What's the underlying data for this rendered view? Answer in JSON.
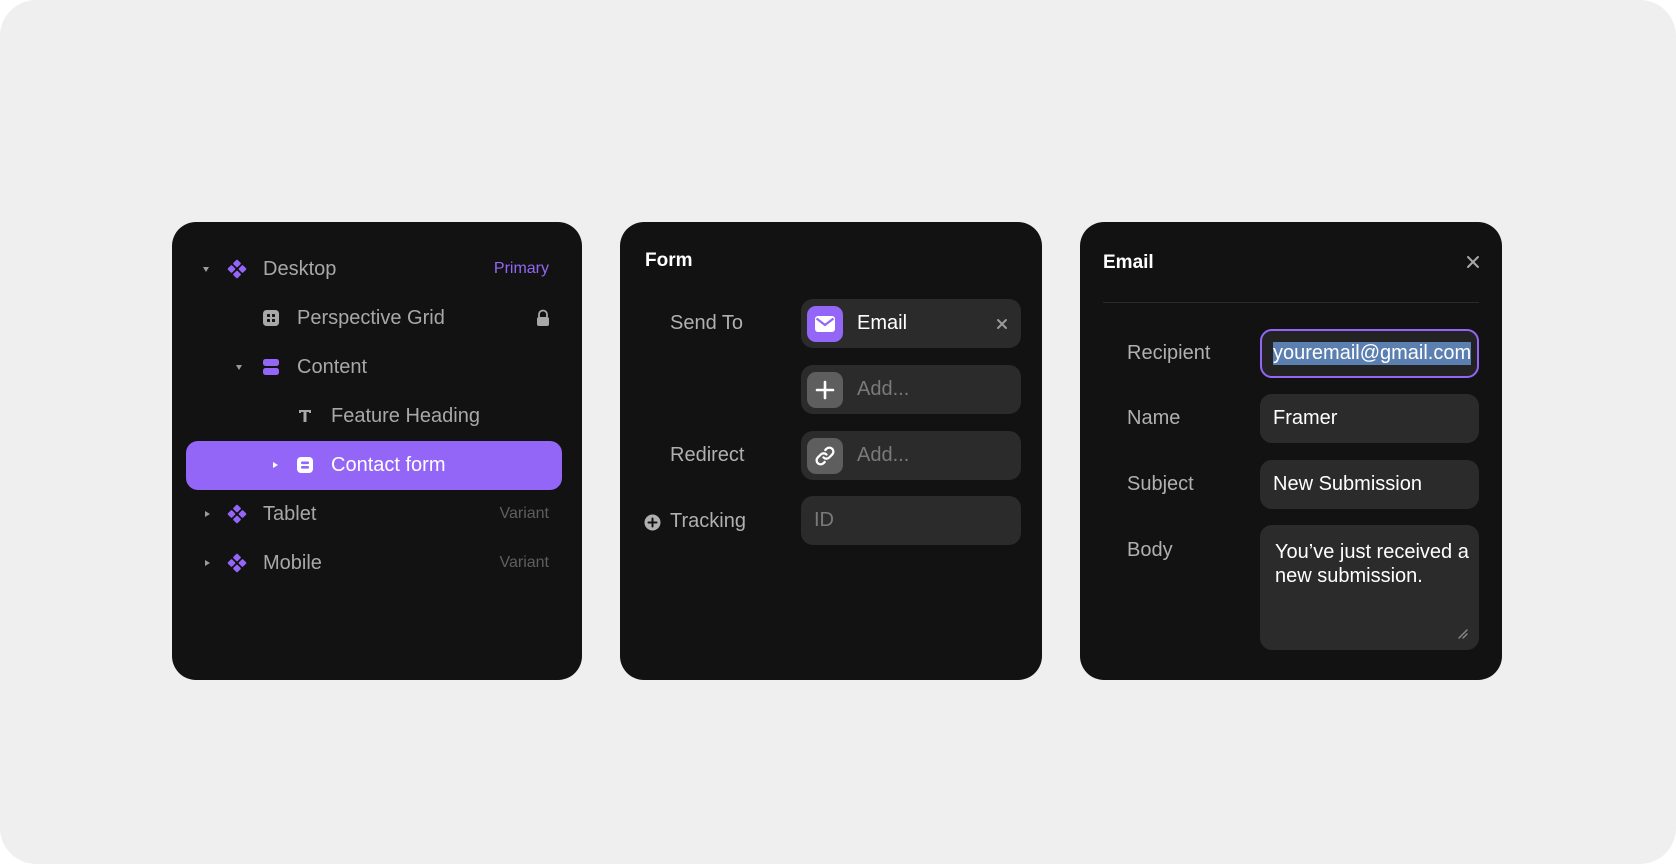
{
  "layers": {
    "items": [
      {
        "label": "Desktop",
        "tag": "Primary",
        "icon": "component-icon"
      },
      {
        "label": "Perspective Grid",
        "icon": "grid-icon",
        "locked": true
      },
      {
        "label": "Content",
        "icon": "stack-icon"
      },
      {
        "label": "Feature Heading",
        "icon": "text-icon"
      },
      {
        "label": "Contact form",
        "icon": "stack-icon",
        "selected": true
      },
      {
        "label": "Tablet",
        "tag": "Variant",
        "icon": "component-icon"
      },
      {
        "label": "Mobile",
        "tag": "Variant",
        "icon": "component-icon"
      }
    ]
  },
  "form": {
    "title": "Form",
    "send_to_label": "Send To",
    "send_to_value": "Email",
    "add_placeholder": "Add...",
    "redirect_label": "Redirect",
    "redirect_placeholder": "Add...",
    "tracking_label": "Tracking",
    "tracking_placeholder": "ID"
  },
  "email": {
    "title": "Email",
    "recipient_label": "Recipient",
    "recipient_value": "youremail@gmail.com",
    "name_label": "Name",
    "name_value": "Framer",
    "subject_label": "Subject",
    "subject_value": "New Submission",
    "body_label": "Body",
    "body_value": "You’ve just received a new submission."
  },
  "colors": {
    "accent": "#9466f7",
    "panel": "#121212",
    "field": "#2b2b2b",
    "background": "#efefef"
  }
}
